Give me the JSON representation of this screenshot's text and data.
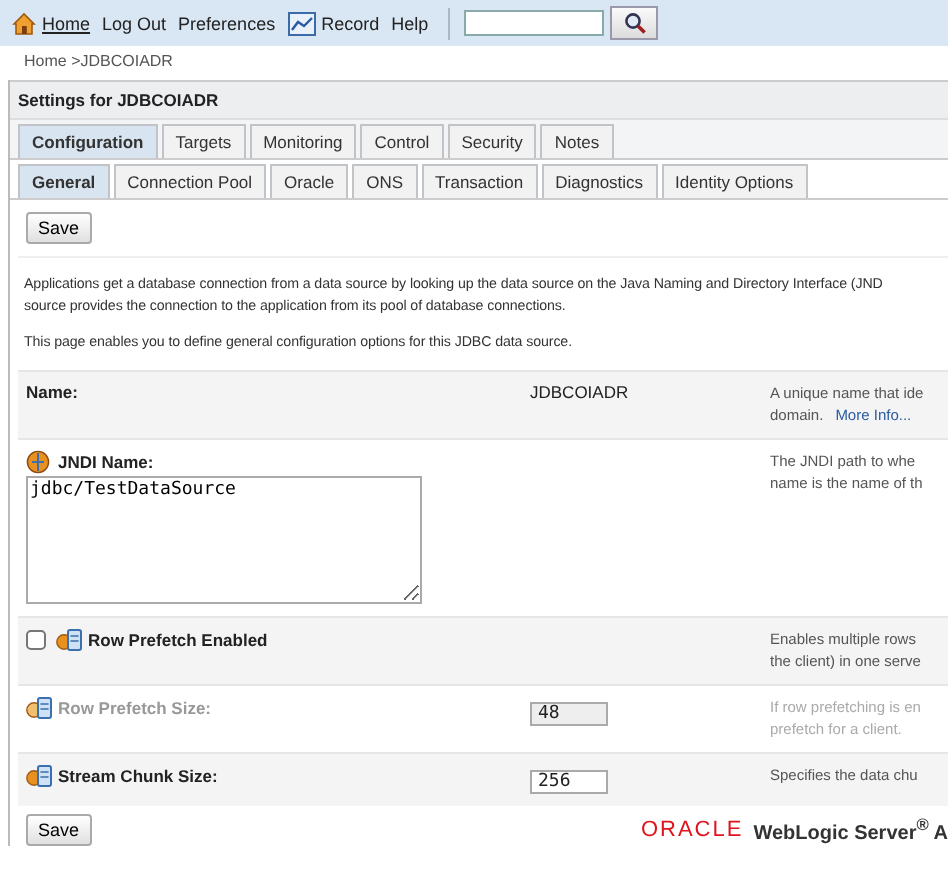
{
  "toolbar": {
    "links": [
      {
        "label": "Home",
        "underlined": true
      },
      {
        "label": "Log Out",
        "underlined": false
      },
      {
        "label": "Preferences",
        "underlined": false
      },
      {
        "label": "Record",
        "underlined": false
      },
      {
        "label": "Help",
        "underlined": false
      }
    ]
  },
  "breadcrumb": "Home >JDBCOIADR",
  "panel_title": "Settings for JDBCOIADR",
  "tabs": [
    {
      "label": "Configuration",
      "selected": true
    },
    {
      "label": "Targets",
      "selected": false
    },
    {
      "label": "Monitoring",
      "selected": false
    },
    {
      "label": "Control",
      "selected": false
    },
    {
      "label": "Security",
      "selected": false
    },
    {
      "label": "Notes",
      "selected": false
    }
  ],
  "subtabs": [
    {
      "label": "General",
      "selected": true
    },
    {
      "label": "Connection Pool",
      "selected": false
    },
    {
      "label": "Oracle",
      "selected": false
    },
    {
      "label": "ONS",
      "selected": false
    },
    {
      "label": "Transaction",
      "selected": false
    },
    {
      "label": "Diagnostics",
      "selected": false
    },
    {
      "label": "Identity Options",
      "selected": false
    }
  ],
  "save_top": "Save",
  "intro": [
    "Applications get a database connection from a data source by looking up the data source on the Java Naming and Directory Interface (JND",
    "source provides the connection to the application from its pool of database connections."
  ],
  "intro_note": "This page enables you to define general configuration options for this JDBC data source.",
  "fields": [
    {
      "kind": "static",
      "label": "Name:",
      "value": "JDBCOIADR",
      "help": [
        "A unique name that ide",
        "domain."
      ],
      "link": "More Info..."
    },
    {
      "kind": "textarea",
      "label": "JNDI Name:",
      "icon": true,
      "value": "jdbc/TestDataSource",
      "help": [
        "The JNDI path to whe",
        "name is the name of th"
      ]
    },
    {
      "kind": "checkbox",
      "label": "Row Prefetch Enabled",
      "icon": true,
      "checked": false,
      "help": [
        "Enables multiple rows",
        "the client) in one serve"
      ]
    },
    {
      "kind": "number",
      "label": "Row Prefetch Size:",
      "icon": true,
      "disabled": true,
      "value": "48",
      "help": [
        "If row prefetching is en",
        "prefetch for a client."
      ]
    },
    {
      "kind": "number",
      "label": "Stream Chunk Size:",
      "icon": true,
      "value": "256",
      "help": [
        "Specifies the data chu"
      ]
    }
  ],
  "save_bottom": "Save",
  "footer": {
    "brand": "ORACLE",
    "product": "WebLogic Server$^{®}$ A"
  }
}
